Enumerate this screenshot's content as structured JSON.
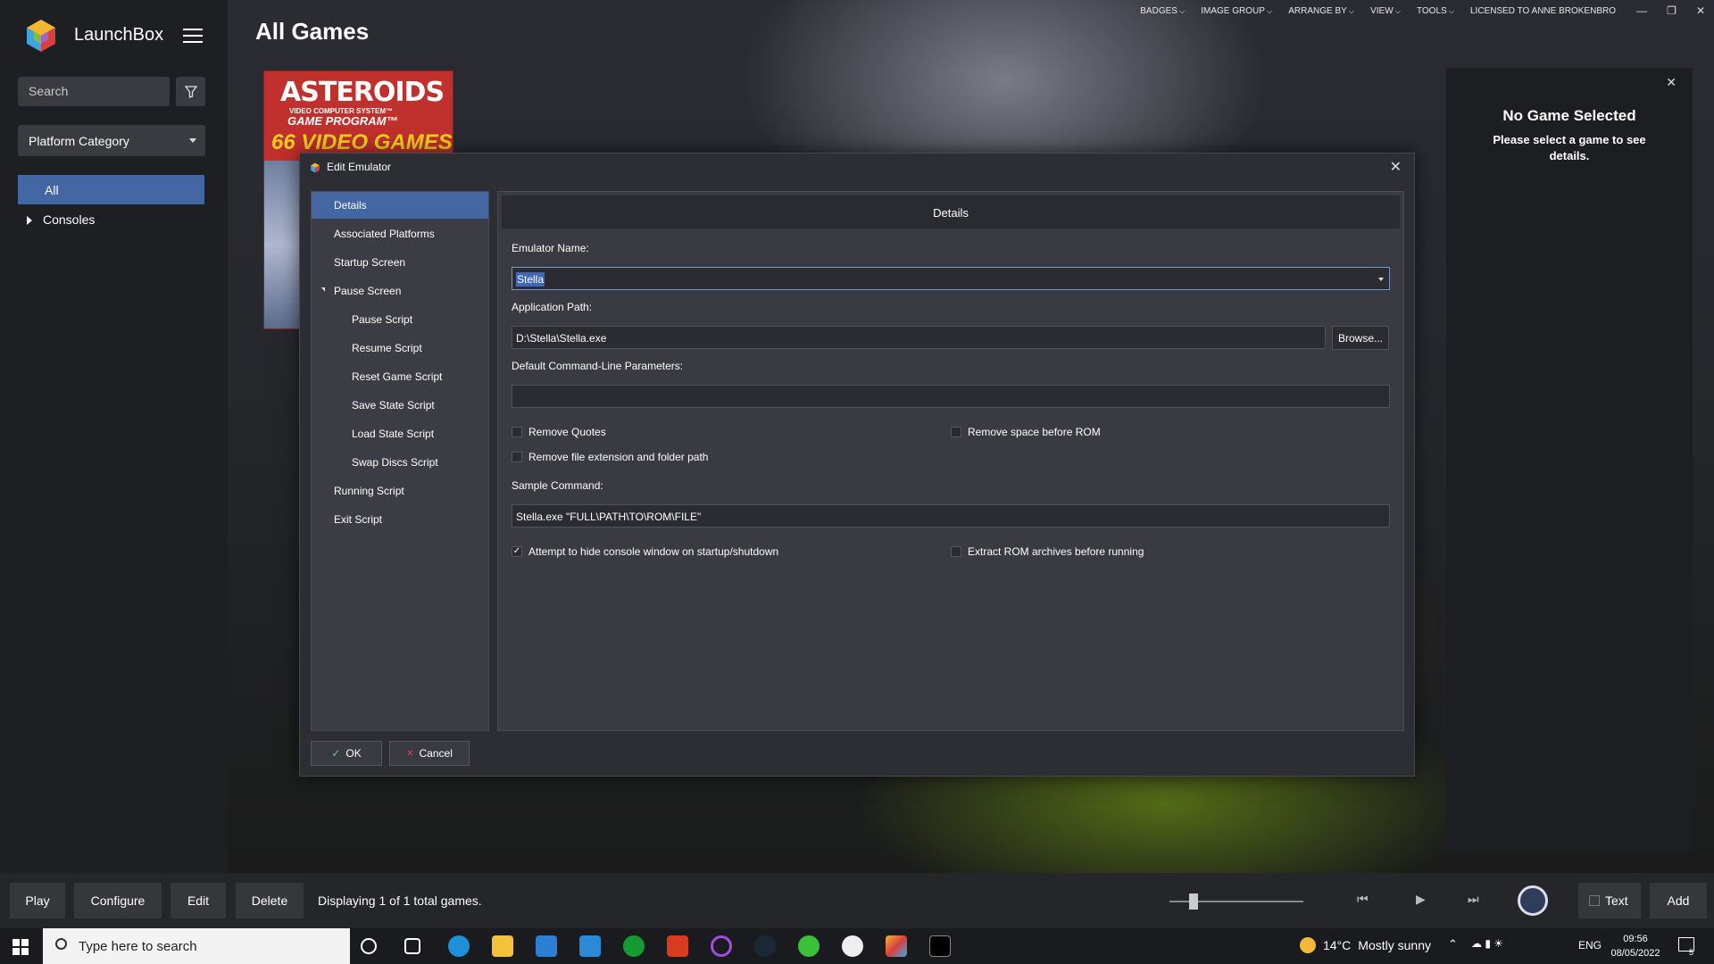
{
  "app": {
    "name": "LaunchBox",
    "page_title": "All Games"
  },
  "sidebar": {
    "search_placeholder": "Search",
    "platform_dropdown": "Platform Category",
    "items": [
      {
        "label": "All"
      },
      {
        "label": "Consoles"
      }
    ]
  },
  "top_menu": {
    "items": [
      "BADGES",
      "IMAGE GROUP",
      "ARRANGE BY",
      "VIEW",
      "TOOLS"
    ],
    "license": "LICENSED TO ANNE BROKENBRO"
  },
  "cover": {
    "title": "ASTEROIDS",
    "line1": "VIDEO COMPUTER SYSTEM™",
    "line2": "GAME PROGRAM™",
    "line3": "66 VIDEO GAMES"
  },
  "right_panel": {
    "title": "No Game Selected",
    "subtitle": "Please select a game to see details."
  },
  "dialog": {
    "title": "Edit Emulator",
    "nav": [
      {
        "label": "Details",
        "selected": true
      },
      {
        "label": "Associated Platforms"
      },
      {
        "label": "Startup Screen"
      },
      {
        "label": "Pause Screen",
        "expanded": true
      },
      {
        "label": "Pause Script"
      },
      {
        "label": "Resume Script"
      },
      {
        "label": "Reset Game Script"
      },
      {
        "label": "Save State Script"
      },
      {
        "label": "Load State Script"
      },
      {
        "label": "Swap Discs Script"
      },
      {
        "label": "Running Script"
      },
      {
        "label": "Exit Script"
      }
    ],
    "content_header": "Details",
    "emulator_name_label": "Emulator Name:",
    "emulator_name_value": "Stella",
    "app_path_label": "Application Path:",
    "app_path_value": "D:\\Stella\\Stella.exe",
    "browse_label": "Browse...",
    "cmd_params_label": "Default Command-Line Parameters:",
    "cmd_params_value": "",
    "checkboxes": {
      "remove_quotes": {
        "label": "Remove Quotes",
        "checked": false
      },
      "remove_space": {
        "label": "Remove space before ROM",
        "checked": false
      },
      "remove_ext": {
        "label": "Remove file extension and folder path",
        "checked": false
      },
      "hide_console": {
        "label": "Attempt to hide console window on startup/shutdown",
        "checked": true
      },
      "extract_rom": {
        "label": "Extract ROM archives before running",
        "checked": false
      }
    },
    "sample_label": "Sample Command:",
    "sample_value": "Stella.exe \"FULL\\PATH\\TO\\ROM\\FILE\"",
    "ok_label": "OK",
    "cancel_label": "Cancel"
  },
  "bottom_bar": {
    "play": "Play",
    "configure": "Configure",
    "edit": "Edit",
    "delete": "Delete",
    "status": "Displaying 1 of 1 total games.",
    "text_toggle": "Text",
    "add": "Add"
  },
  "taskbar": {
    "search_placeholder": "Type here to search",
    "weather_temp": "14°C",
    "weather_desc": "Mostly sunny",
    "lang": "ENG",
    "time": "09:56",
    "date": "08/05/2022",
    "notif_count": "5"
  },
  "colors": {
    "accent": "#4466a3",
    "dialog_bg": "#2d2e34",
    "sidebar_bg": "#1e1f22"
  }
}
